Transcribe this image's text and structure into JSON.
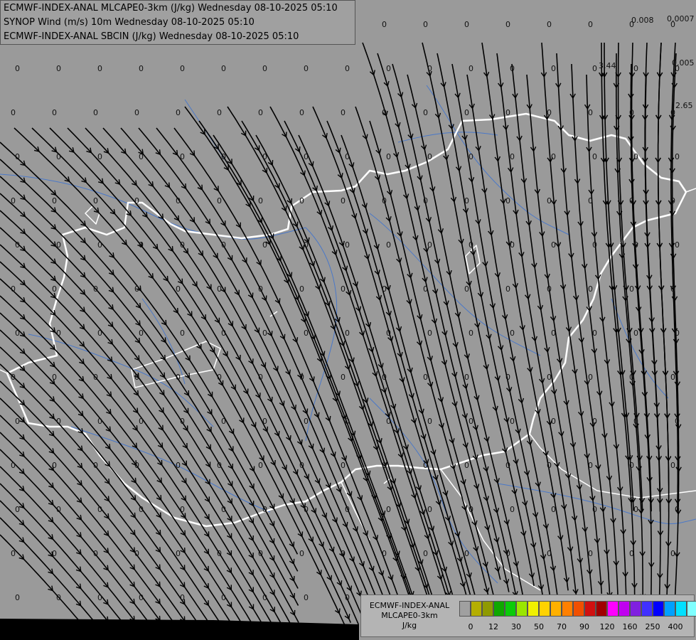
{
  "titles": [
    "ECMWF-INDEX-ANAL MLCAPE0-3km (J/kg) Wednesday 08-10-2025 05:10",
    "SYNOP Wind (m/s) 10m Wednesday 08-10-2025 05:10",
    "ECMWF-INDEX-ANAL SBCIN (J/kg) Wednesday 08-10-2025 05:10"
  ],
  "grid_values": {
    "common": "0",
    "special": [
      "0.008",
      "0.0007",
      "0.005",
      "3.44",
      "2.65"
    ]
  },
  "legend": {
    "name_line1": "ECMWF-INDEX-ANAL",
    "name_line2": "MLCAPE0-3km",
    "unit": "J/kg",
    "ticks": [
      "0",
      "12",
      "30",
      "50",
      "70",
      "90",
      "120",
      "160",
      "250",
      "400"
    ],
    "colors": [
      "#a0a0a0",
      "#b4ae00",
      "#8f9a00",
      "#0fa800",
      "#0acb0a",
      "#9ae600",
      "#f0f000",
      "#ffd200",
      "#ffb000",
      "#ff8000",
      "#f05000",
      "#d01010",
      "#a00000",
      "#ff00ff",
      "#c000f0",
      "#8020e0",
      "#4030ff",
      "#0000ff",
      "#00a0ff",
      "#00e0ff",
      "#80ffff",
      "#ffffff"
    ]
  },
  "colors": {
    "background": "#9a9a9a",
    "border_line": "#ffffff",
    "river": "#4a78c8",
    "streamline": "#000000"
  }
}
